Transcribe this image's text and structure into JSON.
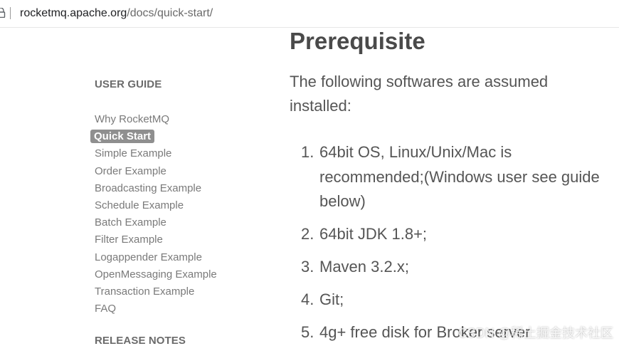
{
  "browser": {
    "url_domain": "rocketmq.apache.org",
    "url_path": "/docs/quick-start/"
  },
  "sidebar": {
    "user_guide_heading": "USER GUIDE",
    "items": [
      {
        "label": "Why RocketMQ"
      },
      {
        "label": "Quick Start"
      },
      {
        "label": "Simple Example"
      },
      {
        "label": "Order Example"
      },
      {
        "label": "Broadcasting Example"
      },
      {
        "label": "Schedule Example"
      },
      {
        "label": "Batch Example"
      },
      {
        "label": "Filter Example"
      },
      {
        "label": "Logappender Example"
      },
      {
        "label": "OpenMessaging Example"
      },
      {
        "label": "Transaction Example"
      },
      {
        "label": "FAQ"
      }
    ],
    "active_item": "Quick Start",
    "release_notes_heading": "RELEASE NOTES"
  },
  "main": {
    "title": "Prerequisite",
    "intro": "The following softwares are assumed installed:",
    "requirements": [
      {
        "num": "1.",
        "text": "64bit OS, Linux/Unix/Mac is recommended;(Windows user see guide below)"
      },
      {
        "num": "2.",
        "text": "64bit JDK 1.8+;"
      },
      {
        "num": "3.",
        "text": "Maven 3.2.x;"
      },
      {
        "num": "4.",
        "text": "Git;"
      },
      {
        "num": "5.",
        "text": "4g+ free disk for Broker server"
      }
    ]
  },
  "watermark": "CSDN @稀土掘金技术社区",
  "colors": {
    "active_badge": "#8f8f8f",
    "sidebar_text": "#7a7a7a",
    "body_text": "#555555",
    "title_text": "#4a4a4a"
  }
}
